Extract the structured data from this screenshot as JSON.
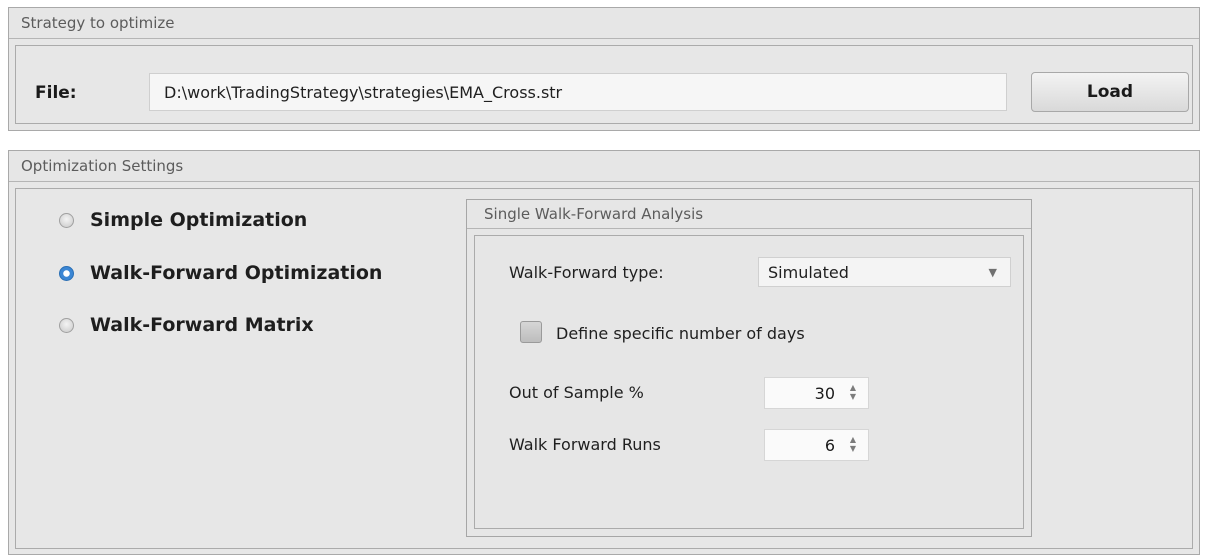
{
  "strategy_group": {
    "title": "Strategy to optimize",
    "file_label": "File:",
    "file_path": "D:\\work\\TradingStrategy\\strategies\\EMA_Cross.str",
    "load_label": "Load"
  },
  "optimization_group": {
    "title": "Optimization Settings",
    "modes": [
      {
        "label": "Simple Optimization",
        "checked": false
      },
      {
        "label": "Walk-Forward Optimization",
        "checked": true
      },
      {
        "label": "Walk-Forward Matrix",
        "checked": false
      }
    ],
    "walk_forward_panel": {
      "title": "Single Walk-Forward Analysis",
      "type_label": "Walk-Forward type:",
      "type_value": "Simulated",
      "define_days_label": "Define specific number of days",
      "define_days_checked": false,
      "out_of_sample_label": "Out of Sample %",
      "out_of_sample_value": "30",
      "runs_label": "Walk Forward Runs",
      "runs_value": "6"
    }
  },
  "colors": {
    "panel_bg": "#e7e7e7",
    "radio_checked": "#3b86d4"
  }
}
